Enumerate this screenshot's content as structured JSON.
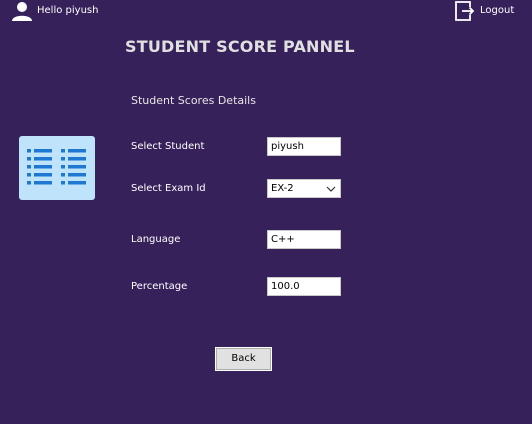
{
  "header": {
    "greeting": "Hello piyush",
    "logout_label": "Logout",
    "user_icon": "user-icon",
    "logout_icon": "logout-icon"
  },
  "page_title": "STUDENT SCORE PANNEL",
  "section_title": "Student Scores Details",
  "illustration_icon": "list-icon",
  "form": {
    "student_label": "Select Student",
    "student_value": "piyush",
    "exam_label": "Select Exam Id",
    "exam_value": "EX-2",
    "language_label": "Language",
    "language_value": "C++",
    "percentage_label": "Percentage",
    "percentage_value": "100.0"
  },
  "back_label": "Back",
  "colors": {
    "background": "#36215a",
    "icon_panel": "#bfe3fb",
    "icon_lines": "#1e78d2"
  }
}
